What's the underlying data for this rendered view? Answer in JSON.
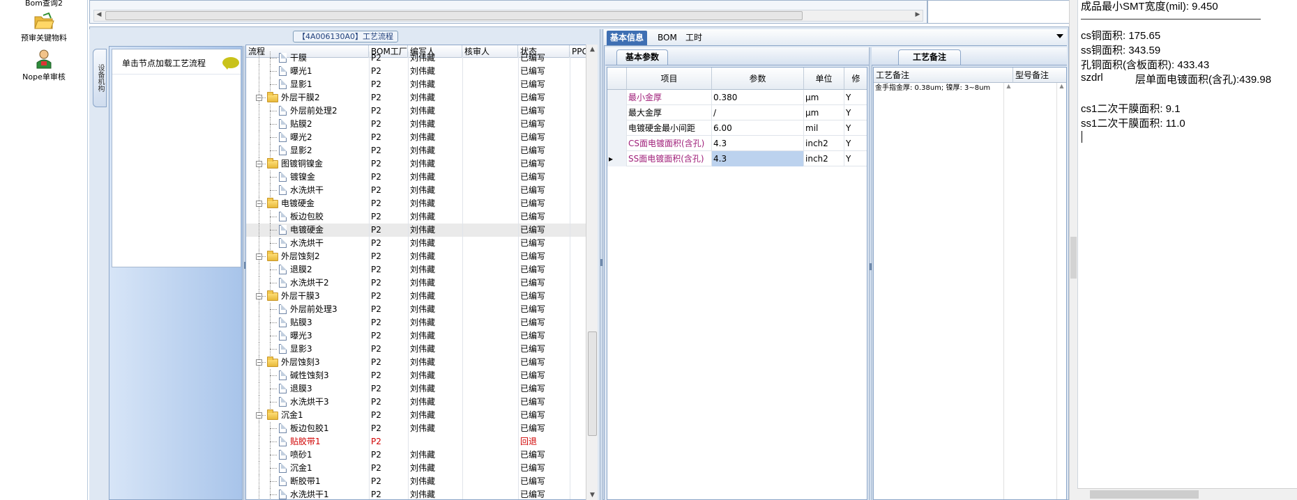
{
  "nav": {
    "items": [
      {
        "label": "Bom查询2",
        "icon": "search-doc-icon"
      },
      {
        "label": "预审关键物料",
        "icon": "folder-open-icon"
      },
      {
        "label": "Nope单审核",
        "icon": "user-icon"
      }
    ]
  },
  "process_panel": {
    "title": "【4A006130A0】工艺流程",
    "side_tab": "设备机构",
    "hint": "单击节点加载工艺流程",
    "columns": [
      "流程",
      "BOM工厂",
      "编写人",
      "核审人",
      "状态",
      "PPC"
    ],
    "rows": [
      {
        "name": "干膜",
        "level": 2,
        "type": "doc",
        "factory": "P2",
        "writer": "刘伟藏",
        "reviewer": "",
        "status": "已编写",
        "partial": true
      },
      {
        "name": "曝光1",
        "level": 2,
        "type": "doc",
        "factory": "P2",
        "writer": "刘伟藏",
        "reviewer": "",
        "status": "已编写"
      },
      {
        "name": "显影1",
        "level": 2,
        "type": "doc",
        "factory": "P2",
        "writer": "刘伟藏",
        "reviewer": "",
        "status": "已编写"
      },
      {
        "name": "外层干膜2",
        "level": 1,
        "type": "folder",
        "factory": "P2",
        "writer": "刘伟藏",
        "reviewer": "",
        "status": "已编写"
      },
      {
        "name": "外层前处理2",
        "level": 2,
        "type": "doc",
        "factory": "P2",
        "writer": "刘伟藏",
        "reviewer": "",
        "status": "已编写"
      },
      {
        "name": "贴膜2",
        "level": 2,
        "type": "doc",
        "factory": "P2",
        "writer": "刘伟藏",
        "reviewer": "",
        "status": "已编写"
      },
      {
        "name": "曝光2",
        "level": 2,
        "type": "doc",
        "factory": "P2",
        "writer": "刘伟藏",
        "reviewer": "",
        "status": "已编写"
      },
      {
        "name": "显影2",
        "level": 2,
        "type": "doc",
        "factory": "P2",
        "writer": "刘伟藏",
        "reviewer": "",
        "status": "已编写"
      },
      {
        "name": "图镀铜镍金",
        "level": 1,
        "type": "folder",
        "factory": "P2",
        "writer": "刘伟藏",
        "reviewer": "",
        "status": "已编写"
      },
      {
        "name": "镀镍金",
        "level": 2,
        "type": "doc",
        "factory": "P2",
        "writer": "刘伟藏",
        "reviewer": "",
        "status": "已编写"
      },
      {
        "name": "水洗烘干",
        "level": 2,
        "type": "doc",
        "factory": "P2",
        "writer": "刘伟藏",
        "reviewer": "",
        "status": "已编写"
      },
      {
        "name": "电镀硬金",
        "level": 1,
        "type": "folder",
        "factory": "P2",
        "writer": "刘伟藏",
        "reviewer": "",
        "status": "已编写"
      },
      {
        "name": "板边包胶",
        "level": 2,
        "type": "doc",
        "factory": "P2",
        "writer": "刘伟藏",
        "reviewer": "",
        "status": "已编写"
      },
      {
        "name": "电镀硬金",
        "level": 2,
        "type": "doc",
        "factory": "P2",
        "writer": "刘伟藏",
        "reviewer": "",
        "status": "已编写",
        "selected": true
      },
      {
        "name": "水洗烘干",
        "level": 2,
        "type": "doc",
        "factory": "P2",
        "writer": "刘伟藏",
        "reviewer": "",
        "status": "已编写"
      },
      {
        "name": "外层蚀刻2",
        "level": 1,
        "type": "folder",
        "factory": "P2",
        "writer": "刘伟藏",
        "reviewer": "",
        "status": "已编写"
      },
      {
        "name": "退膜2",
        "level": 2,
        "type": "doc",
        "factory": "P2",
        "writer": "刘伟藏",
        "reviewer": "",
        "status": "已编写"
      },
      {
        "name": "水洗烘干2",
        "level": 2,
        "type": "doc",
        "factory": "P2",
        "writer": "刘伟藏",
        "reviewer": "",
        "status": "已编写"
      },
      {
        "name": "外层干膜3",
        "level": 1,
        "type": "folder",
        "factory": "P2",
        "writer": "刘伟藏",
        "reviewer": "",
        "status": "已编写"
      },
      {
        "name": "外层前处理3",
        "level": 2,
        "type": "doc",
        "factory": "P2",
        "writer": "刘伟藏",
        "reviewer": "",
        "status": "已编写"
      },
      {
        "name": "贴膜3",
        "level": 2,
        "type": "doc",
        "factory": "P2",
        "writer": "刘伟藏",
        "reviewer": "",
        "status": "已编写"
      },
      {
        "name": "曝光3",
        "level": 2,
        "type": "doc",
        "factory": "P2",
        "writer": "刘伟藏",
        "reviewer": "",
        "status": "已编写"
      },
      {
        "name": "显影3",
        "level": 2,
        "type": "doc",
        "factory": "P2",
        "writer": "刘伟藏",
        "reviewer": "",
        "status": "已编写"
      },
      {
        "name": "外层蚀刻3",
        "level": 1,
        "type": "folder",
        "factory": "P2",
        "writer": "刘伟藏",
        "reviewer": "",
        "status": "已编写"
      },
      {
        "name": "碱性蚀刻3",
        "level": 2,
        "type": "doc",
        "factory": "P2",
        "writer": "刘伟藏",
        "reviewer": "",
        "status": "已编写"
      },
      {
        "name": "退膜3",
        "level": 2,
        "type": "doc",
        "factory": "P2",
        "writer": "刘伟藏",
        "reviewer": "",
        "status": "已编写"
      },
      {
        "name": "水洗烘干3",
        "level": 2,
        "type": "doc",
        "factory": "P2",
        "writer": "刘伟藏",
        "reviewer": "",
        "status": "已编写"
      },
      {
        "name": "沉金1",
        "level": 1,
        "type": "folder",
        "factory": "P2",
        "writer": "刘伟藏",
        "reviewer": "",
        "status": "已编写"
      },
      {
        "name": "板边包胶1",
        "level": 2,
        "type": "doc",
        "factory": "P2",
        "writer": "刘伟藏",
        "reviewer": "",
        "status": "已编写"
      },
      {
        "name": "贴胶带1",
        "level": 2,
        "type": "doc",
        "factory": "P2",
        "writer": "",
        "reviewer": "",
        "status": "回退",
        "red": true
      },
      {
        "name": "喷砂1",
        "level": 2,
        "type": "doc",
        "factory": "P2",
        "writer": "刘伟藏",
        "reviewer": "",
        "status": "已编写"
      },
      {
        "name": "沉金1",
        "level": 2,
        "type": "doc",
        "factory": "P2",
        "writer": "刘伟藏",
        "reviewer": "",
        "status": "已编写"
      },
      {
        "name": "断胶带1",
        "level": 2,
        "type": "doc",
        "factory": "P2",
        "writer": "刘伟藏",
        "reviewer": "",
        "status": "已编写"
      },
      {
        "name": "水洗烘干1",
        "level": 2,
        "type": "doc",
        "factory": "P2",
        "writer": "刘伟藏",
        "reviewer": "",
        "status": "已编写"
      }
    ]
  },
  "info_panel": {
    "tabs": [
      "基本信息",
      "BOM",
      "工时"
    ],
    "active_tab": "基本信息",
    "param_tab": "基本参数",
    "param_columns": [
      "项目",
      "参数",
      "单位",
      "修"
    ],
    "params": [
      {
        "item": "最小金厚",
        "value": "0.380",
        "unit": "μm",
        "flag": "Y",
        "color": "#a0207a"
      },
      {
        "item": "最大金厚",
        "value": "/",
        "unit": "μm",
        "flag": "Y",
        "color": "#000000"
      },
      {
        "item": "电镀硬金最小间距",
        "value": "6.00",
        "unit": "mil",
        "flag": "Y",
        "color": "#000000"
      },
      {
        "item": "CS面电镀面积(含孔)",
        "value": "4.3",
        "unit": "inch2",
        "flag": "Y",
        "color": "#a0207a"
      },
      {
        "item": "SS面电镀面积(含孔)",
        "value": "4.3",
        "unit": "inch2",
        "flag": "Y",
        "color": "#a0207a",
        "selected": true
      }
    ],
    "remarks_tab": "工艺备注",
    "remarks_columns": [
      "工艺备注",
      "型号备注"
    ],
    "remark_text": "金手指金厚: 0.38um; 镍厚: 3~8um"
  },
  "right_pane": {
    "lines": [
      "成品最小SMT宽度(mil): 9.450",
      "cs铜面积: 175.65",
      "ss铜面积: 343.59",
      "孔铜面积(含板面积): 433.43",
      "szdrl",
      "层单面电镀面积(含孔):439.98",
      "cs1二次干膜面积: 9.1",
      "ss1二次干膜面积: 11.0"
    ]
  }
}
